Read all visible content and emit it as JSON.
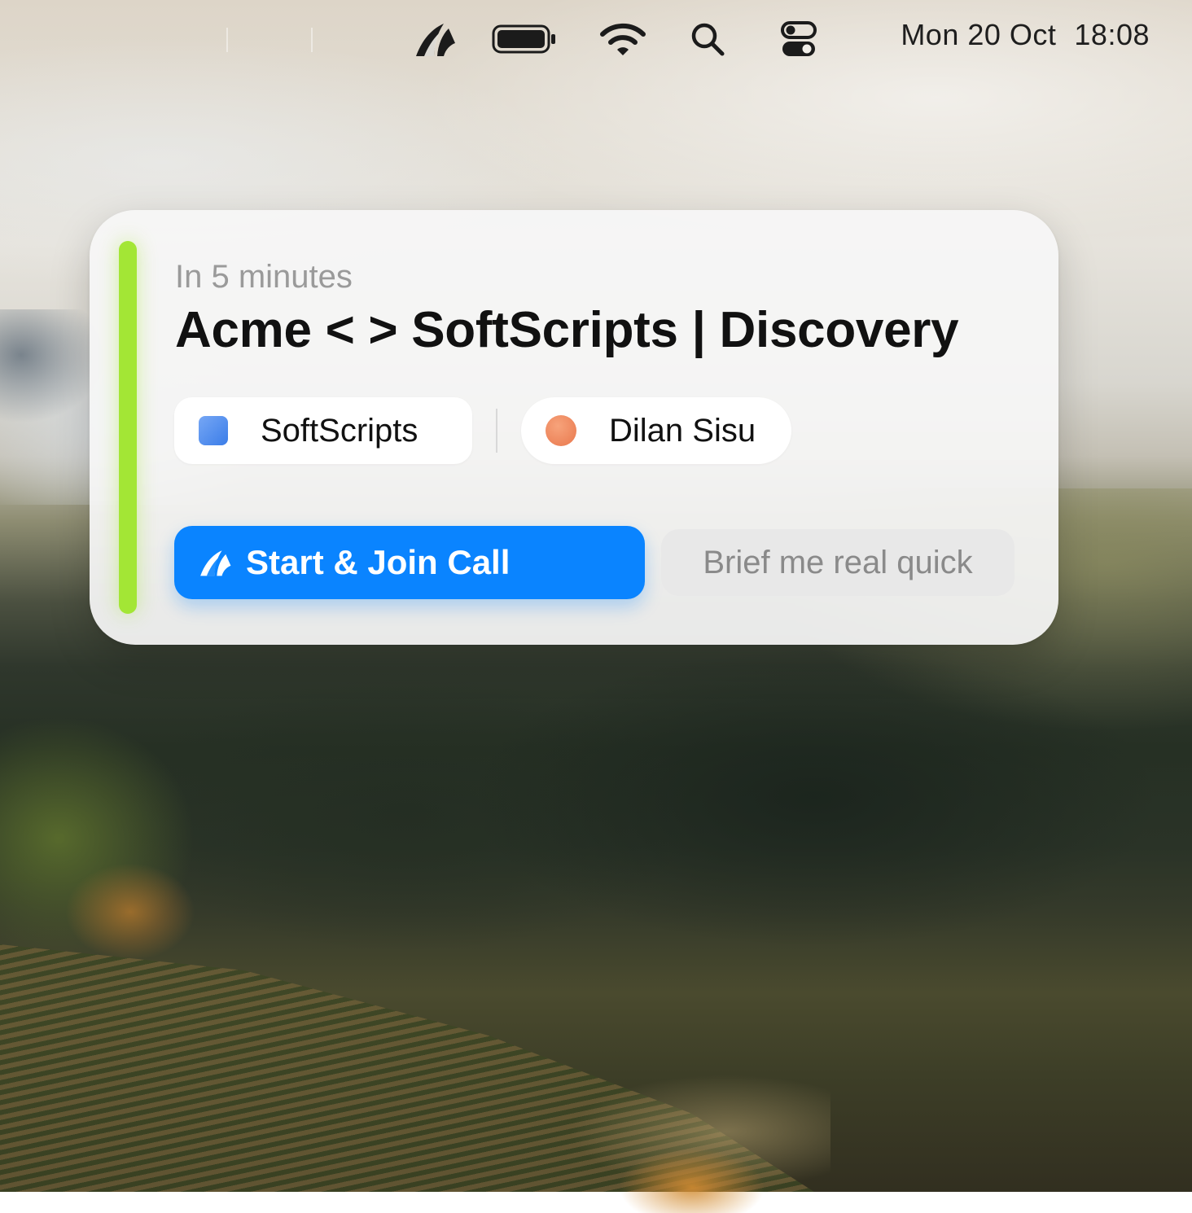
{
  "menubar": {
    "icons": [
      "app-logo-icon",
      "battery-icon",
      "wifi-icon",
      "search-icon",
      "control-center-icon"
    ],
    "date": "Mon 20 Oct",
    "time": "18:08"
  },
  "notification": {
    "subtitle": "In 5 minutes",
    "title": "Acme < > SoftScripts | Discovery",
    "company": {
      "label": "SoftScripts",
      "icon": "company-logo-icon",
      "color": "#4a8df0"
    },
    "attendee": {
      "label": "Dilan Sisu",
      "icon": "avatar-dot-icon",
      "color": "#ef8558"
    },
    "primary_action": {
      "label": "Start & Join Call",
      "icon": "app-logo-icon",
      "color": "#0a84ff"
    },
    "secondary_action": {
      "label": "Brief me real quick"
    },
    "accent_color": "#a3e635"
  }
}
